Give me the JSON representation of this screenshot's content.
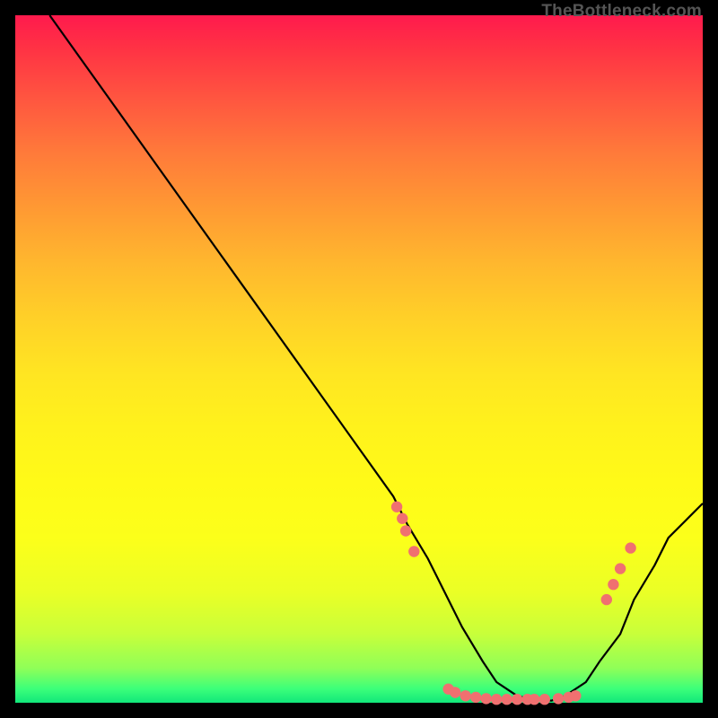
{
  "watermark": "TheBottleneck.com",
  "chart_data": {
    "type": "line",
    "title": "",
    "xlabel": "",
    "ylabel": "",
    "xlim": [
      0,
      100
    ],
    "ylim": [
      0,
      100
    ],
    "series": [
      {
        "name": "curve",
        "x": [
          5,
          10,
          15,
          20,
          25,
          30,
          35,
          40,
          45,
          50,
          55,
          57,
          60,
          63,
          65,
          68,
          70,
          73,
          75,
          78,
          80,
          83,
          85,
          88,
          90,
          93,
          95,
          98,
          100
        ],
        "y": [
          100,
          93,
          86,
          79,
          72,
          65,
          58,
          51,
          44,
          37,
          30,
          26,
          21,
          15,
          11,
          6,
          3,
          1,
          0.5,
          0.3,
          1,
          3,
          6,
          10,
          15,
          20,
          24,
          27,
          29
        ]
      }
    ],
    "scatter_points": [
      {
        "x": 55.5,
        "y": 28.5
      },
      {
        "x": 56.3,
        "y": 26.8
      },
      {
        "x": 56.8,
        "y": 25.0
      },
      {
        "x": 58.0,
        "y": 22.0
      },
      {
        "x": 63.0,
        "y": 2.0
      },
      {
        "x": 64.0,
        "y": 1.5
      },
      {
        "x": 65.5,
        "y": 1.0
      },
      {
        "x": 67.0,
        "y": 0.8
      },
      {
        "x": 68.5,
        "y": 0.6
      },
      {
        "x": 70.0,
        "y": 0.5
      },
      {
        "x": 71.5,
        "y": 0.5
      },
      {
        "x": 73.0,
        "y": 0.5
      },
      {
        "x": 74.5,
        "y": 0.5
      },
      {
        "x": 75.5,
        "y": 0.5
      },
      {
        "x": 77.0,
        "y": 0.5
      },
      {
        "x": 79.0,
        "y": 0.6
      },
      {
        "x": 80.5,
        "y": 0.8
      },
      {
        "x": 81.5,
        "y": 1.0
      },
      {
        "x": 86.0,
        "y": 15.0
      },
      {
        "x": 87.0,
        "y": 17.2
      },
      {
        "x": 88.0,
        "y": 19.5
      },
      {
        "x": 89.5,
        "y": 22.5
      }
    ]
  }
}
